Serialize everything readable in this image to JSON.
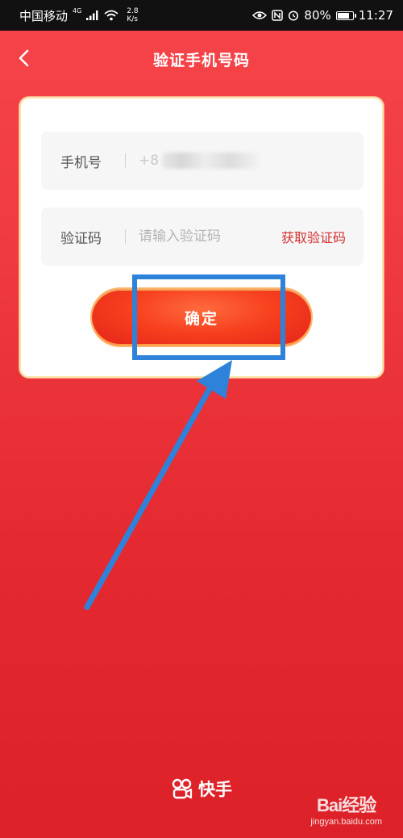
{
  "status_bar": {
    "carrier": "中国移动",
    "network": "4G",
    "speed_value": "2.8",
    "speed_unit": "K/s",
    "battery": "80%",
    "battery_level": 0.8,
    "time": "11:27"
  },
  "nav": {
    "title": "验证手机号码"
  },
  "form": {
    "phone_label": "手机号",
    "phone_value": "+8",
    "code_label": "验证码",
    "code_placeholder": "请输入验证码",
    "get_code_label": "获取验证码",
    "confirm_label": "确定"
  },
  "footer": {
    "brand": "快手"
  },
  "watermark": {
    "main": "Bai经验",
    "sub": "jingyan.baidu.com"
  },
  "colors": {
    "background": "#ef3a40",
    "accent": "#d3302f",
    "annotation": "#2f82d9"
  }
}
